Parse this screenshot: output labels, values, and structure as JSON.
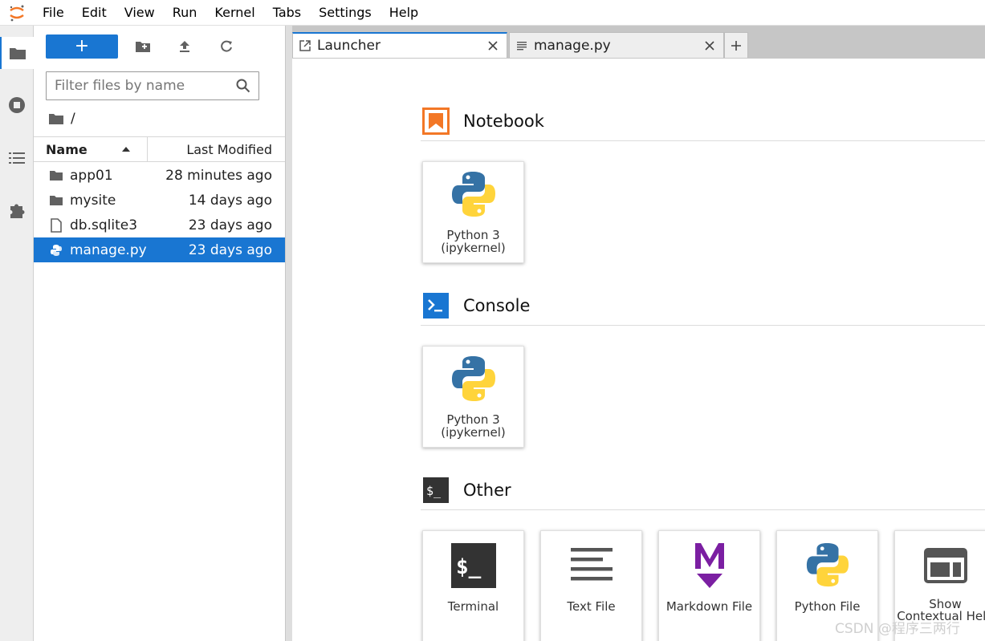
{
  "menu": [
    "File",
    "Edit",
    "View",
    "Run",
    "Kernel",
    "Tabs",
    "Settings",
    "Help"
  ],
  "filebrowser": {
    "new_label": "+",
    "filter_placeholder": "Filter files by name",
    "breadcrumb": "/",
    "col_name": "Name",
    "col_modified": "Last Modified",
    "files": [
      {
        "name": "app01",
        "modified": "28 minutes ago",
        "icon": "folder-icon"
      },
      {
        "name": "mysite",
        "modified": "14 days ago",
        "icon": "folder-icon"
      },
      {
        "name": "db.sqlite3",
        "modified": "23 days ago",
        "icon": "file-icon"
      },
      {
        "name": "manage.py",
        "modified": "23 days ago",
        "icon": "python-icon",
        "selected": true
      }
    ]
  },
  "tabs": [
    {
      "label": "Launcher",
      "icon": "launcher-icon",
      "active": true
    },
    {
      "label": "manage.py",
      "icon": "text-file-icon",
      "active": false
    }
  ],
  "launcher": {
    "notebook": {
      "title": "Notebook",
      "card_line1": "Python 3",
      "card_line2": "(ipykernel)"
    },
    "console": {
      "title": "Console",
      "card_line1": "Python 3",
      "card_line2": "(ipykernel)"
    },
    "other": {
      "title": "Other",
      "cards": [
        "Terminal",
        "Text File",
        "Markdown File",
        "Python File",
        "Show Contextual Help"
      ]
    }
  },
  "colors": {
    "accent": "#1976d2",
    "notebook": "#f37726",
    "markdown": "#7b1fa2"
  },
  "watermark": "CSDN @程序三两行"
}
